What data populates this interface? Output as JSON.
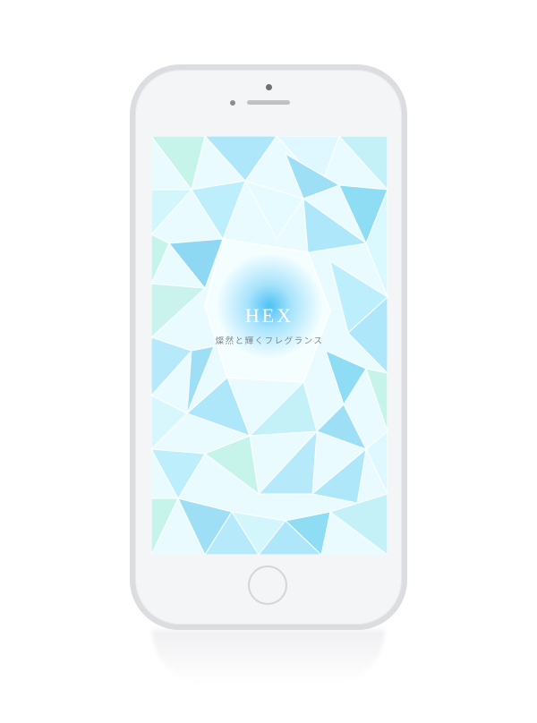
{
  "app": {
    "title": "HEX",
    "tagline": "燦然と輝くフレグランス"
  },
  "colors": {
    "phone_body": "#f4f5f7",
    "phone_border": "#dcdde0",
    "pattern_light": "#dff8ff",
    "pattern_mid": "#b8ecfb",
    "pattern_dark": "#8fdcf5",
    "pattern_mint": "#c7f4ea",
    "glow": "#46bef5"
  },
  "icons": {
    "home_button": "home-button-icon",
    "camera": "front-camera-icon"
  }
}
